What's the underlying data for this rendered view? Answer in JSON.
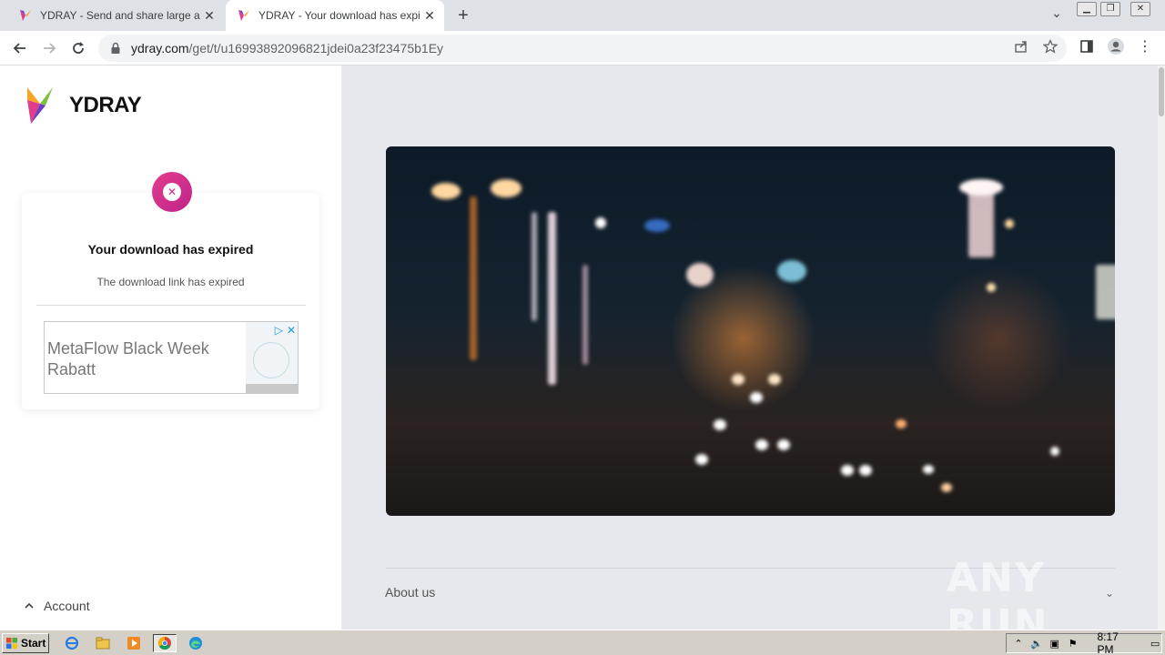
{
  "browser": {
    "tabs": [
      {
        "title": "YDRAY - Send and share large and b",
        "active": false
      },
      {
        "title": "YDRAY - Your download has expired",
        "active": true
      }
    ],
    "new_tab_label": "+",
    "url_domain": "ydray.com",
    "url_path": "/get/t/u16993892096821jdei0a23f23475b1Ey"
  },
  "site": {
    "brand": "YDRAY",
    "card": {
      "title": "Your download has expired",
      "subtitle": "The download link has expired"
    },
    "ad": {
      "text": "MetaFlow Black Week Rabatt"
    },
    "account_label": "Account",
    "about_label": "About us"
  },
  "watermark": "ANY RUN",
  "taskbar": {
    "start_label": "Start",
    "clock": "8:17 PM"
  },
  "colors": {
    "brand_pink": "#e23d8c",
    "chrome_tabstrip": "#dee1e6",
    "page_bg": "#e6e8ee"
  }
}
